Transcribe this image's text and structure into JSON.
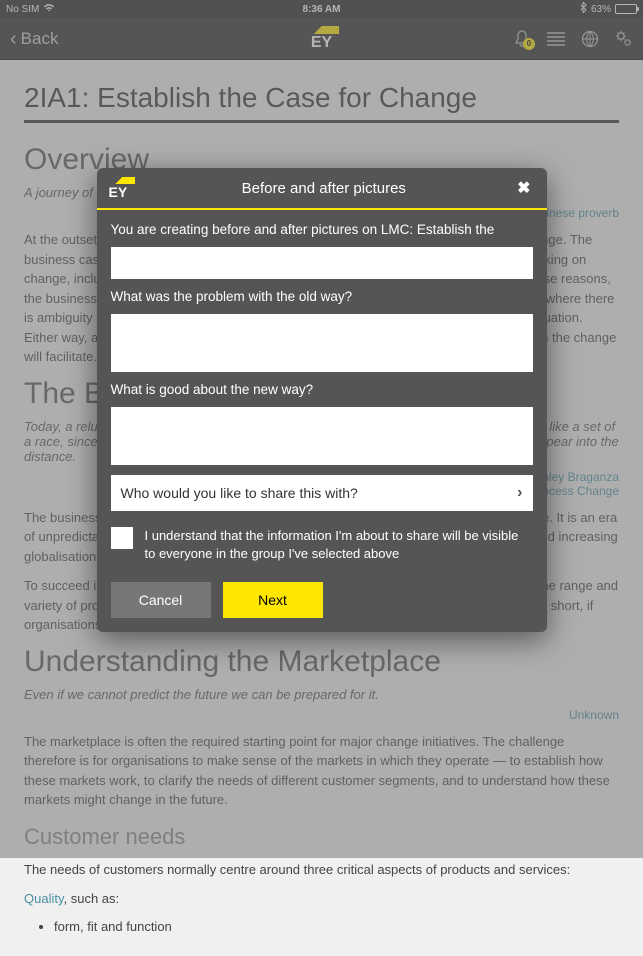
{
  "status": {
    "carrier": "No SIM",
    "time": "8:36 AM",
    "battery_pct": "63%",
    "battery_fill": 63
  },
  "nav": {
    "back": "Back",
    "logo_text": "EY",
    "notif_count": "0"
  },
  "page": {
    "title": "2IA1: Establish the Case for Change",
    "h_overview": "Overview",
    "quote1": "A journey of a thousand miles begins with a single step.",
    "attrib1": "Chinese proverb",
    "para1": "At the outset, the pressures are such that those affected require a convincing case for change. The business case needs to answer fundamental questions which probe the reasons for embarking on change, including what needs to be changed and why it needs to be changed now. For these reasons, the business case should attempt to spell out either the detailed justification for change, or where there is ambiguity over what needs to be done, develop an initial business case to assess the situation. Either way, a business case should ideally set out the potential Return on Investment which the change will facilitate.",
    "h_biz": "The Business Case for Change",
    "quote2": "Today, a reluctance to change actually provides competitors with opportunities. Business is like a set of a race, since any company standing (relatively) still, will see competitors pass by and disappear into the distance.",
    "attrib2": "Ashley Braganza",
    "attrib2b": "Radical Process Change",
    "para2": "The business environment which contemporary organisations face, is turbulent with change. It is an era of unpredictability, typified by shortening product life cycles, rapidly changing technology and increasing globalisation.",
    "para3": "To succeed in such an environment, it is necessary for organisations to be able to deliver the range and variety of products and services demanded by the customer, in ever shorter time frames. In short, if organisations cannot adapt and innovate, they will die.",
    "h_understanding": "Understanding the Marketplace",
    "quote3": "Even if we cannot predict the future we can be prepared for it.",
    "attrib3": "Unknown",
    "para4": "The marketplace is often the required starting point for major change initiatives. The challenge therefore is for organisations to make sense of the markets in which they operate — to establish how these markets work, to clarify the needs of different customer segments, and to understand how these markets might change in the future.",
    "h_customer": "Customer needs",
    "para5": "The needs of customers normally centre around three critical aspects of products and services:",
    "quality_link": "Quality",
    "quality_suffix": ", such as:",
    "bullet1": "form, fit and function"
  },
  "modal": {
    "logo_text": "EY",
    "title": "Before and after pictures",
    "intro": "You are creating before and after pictures on LMC: Establish the",
    "q_problem": "What was the problem with the old way?",
    "q_good": "What is good about the new way?",
    "share_placeholder": "Who would you like to share this with?",
    "consent": "I understand that the information I'm about to share will be visible to everyone in the group I've selected above",
    "cancel": "Cancel",
    "next": "Next"
  }
}
